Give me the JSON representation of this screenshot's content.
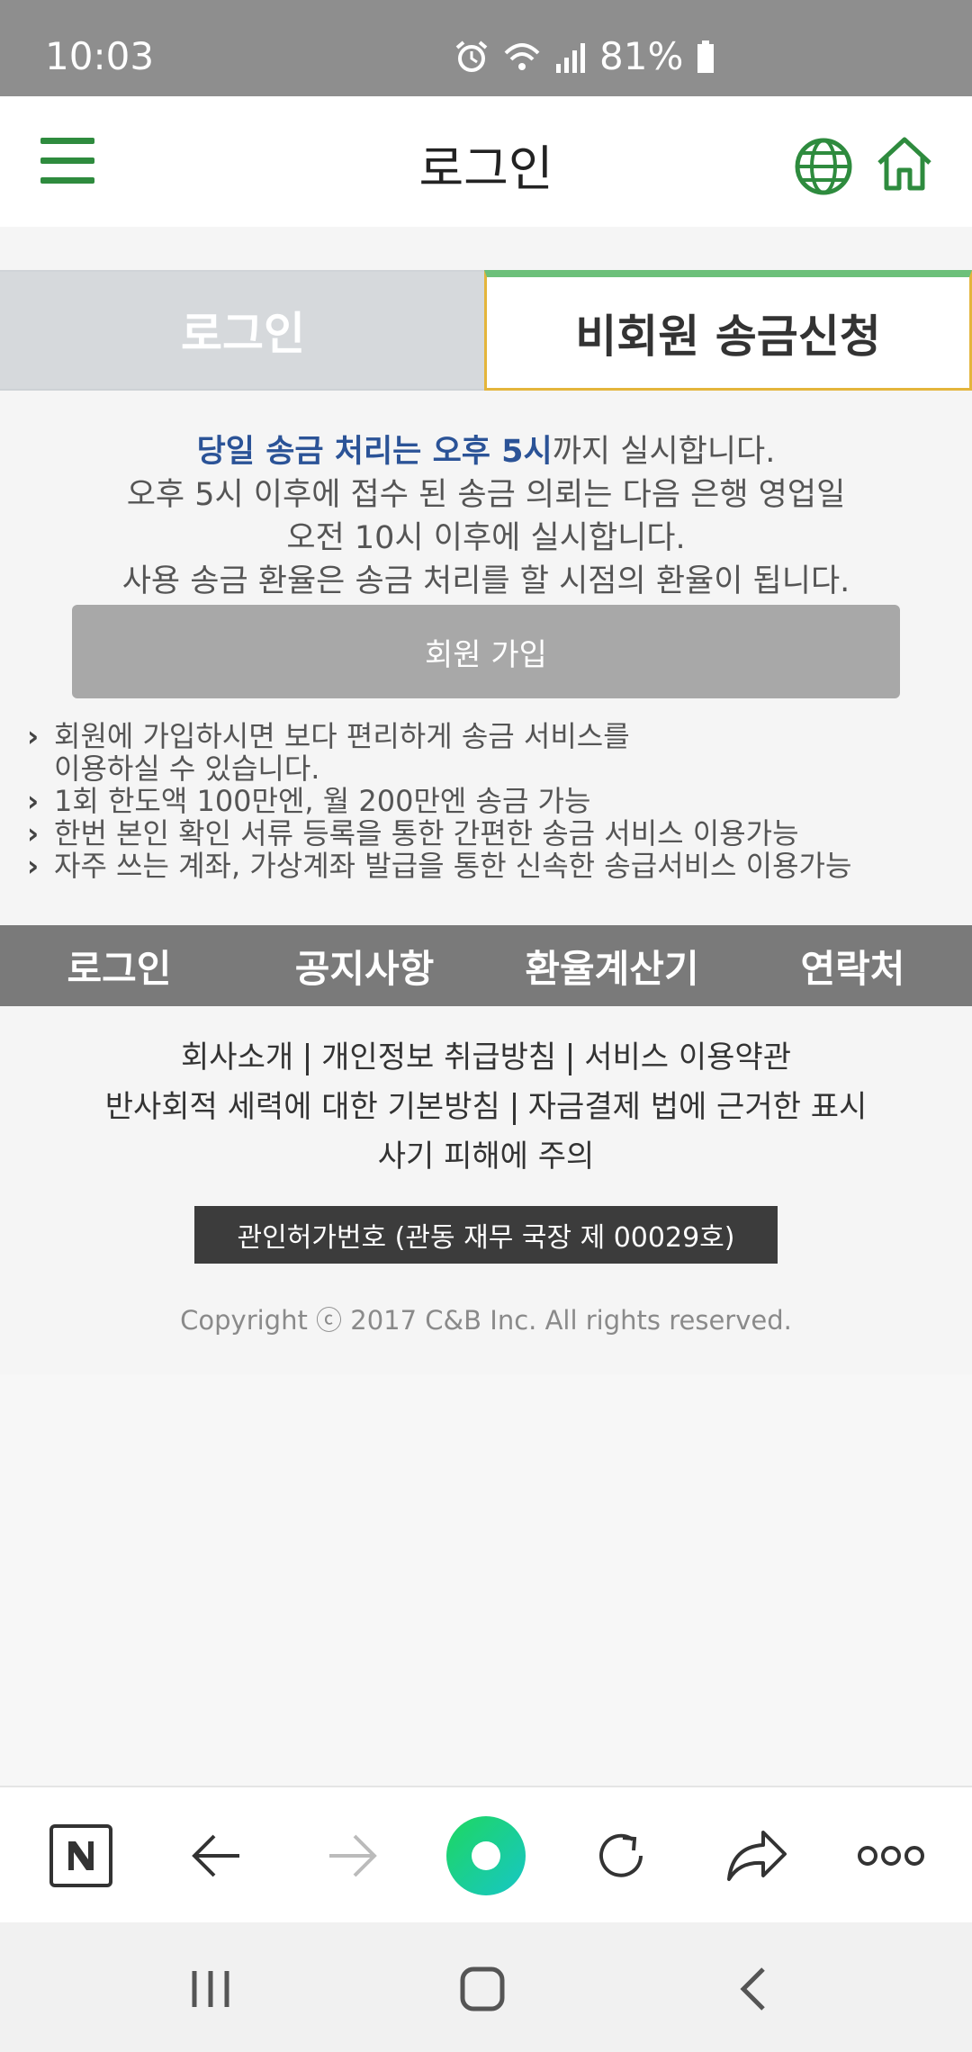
{
  "status_bar": {
    "time": "10:03",
    "battery": "81%"
  },
  "header": {
    "title": "로그인"
  },
  "tabs": {
    "login": "로그인",
    "guest": "비회원 송금신청"
  },
  "notice": {
    "line1_highlight": "당일 송금 처리는 오후 5시",
    "line1_rest": "까지 실시합니다.",
    "line2": "오후 5시 이후에 접수 된 송금 의뢰는 다음 은행 영업일",
    "line3": "오전 10시 이후에 실시합니다.",
    "line4": "사용 송금 환율은 송금 처리를 할 시점의 환율이 됩니다."
  },
  "signup_button": "회원 가입",
  "benefits": [
    "회원에 가입하시면 보다 편리하게 송금 서비스를",
    "이용하실 수 있습니다.",
    "1회 한도액 100만엔, 월 200만엔 송금 가능",
    "한번 본인 확인 서류 등록을 통한 간편한 송금 서비스 이용가능",
    "자주 쓰는 계좌, 가상계좌 발급을 통한 신속한 송급서비스 이용가능"
  ],
  "footer_nav": [
    "로그인",
    "공지사항",
    "환율계산기",
    "연락처"
  ],
  "footer_links": {
    "about": "회사소개",
    "privacy": "개인정보 취급방침",
    "terms": "서비스 이용약관",
    "antisocial": "반사회적 세력에 대한 기본방침",
    "fund_settlement": "자금결제 법에 근거한 표시",
    "fraud": "사기 피해에 주의"
  },
  "license": "관인허가번호 (관동 재무 국장 제 00029호)",
  "copyright": "Copyright ⓒ 2017 C&B Inc. All rights reserved.",
  "colors": {
    "brand_green": "#2e8b3e",
    "notice_blue": "#2b5397",
    "tab_border_yellow": "#e4b53b"
  }
}
